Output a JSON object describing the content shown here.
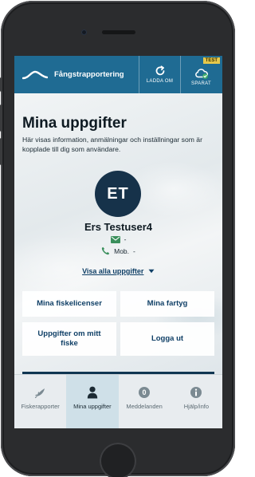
{
  "header": {
    "app_name": "Fångstrapportering",
    "reload_label": "LADDA OM",
    "saved_label": "SPARAT",
    "env_badge": "TEST"
  },
  "profile": {
    "title": "Mina uppgifter",
    "description": "Här visas information, anmälningar och inställningar som är kopplade till dig som användare.",
    "initials": "ET",
    "name": "Ers Testuser4",
    "email_value": "-",
    "mobile_label": "Mob.",
    "mobile_value": "-",
    "show_all_label": "Visa alla uppgifter"
  },
  "tiles": {
    "licenses": "Mina fiskelicenser",
    "vessels": "Mina fartyg",
    "fishing_info": "Uppgifter om mitt fiske",
    "logout": "Logga ut"
  },
  "tabs": [
    {
      "label": "Fiskerapporter",
      "icon": "fish-report-icon",
      "active": false
    },
    {
      "label": "Mina uppgifter",
      "icon": "person-icon",
      "active": true
    },
    {
      "label": "Meddelanden",
      "icon": "message-count-icon",
      "active": false,
      "count": "0"
    },
    {
      "label": "Hjälp/info",
      "icon": "info-icon",
      "active": false
    }
  ],
  "colors": {
    "header_bg": "#1f6b93",
    "accent_text": "#0f3f66",
    "avatar_bg": "#16324a",
    "email_icon": "#3a8f5c",
    "phone_icon": "#3a8f5c",
    "badge": "#e6c84a"
  }
}
